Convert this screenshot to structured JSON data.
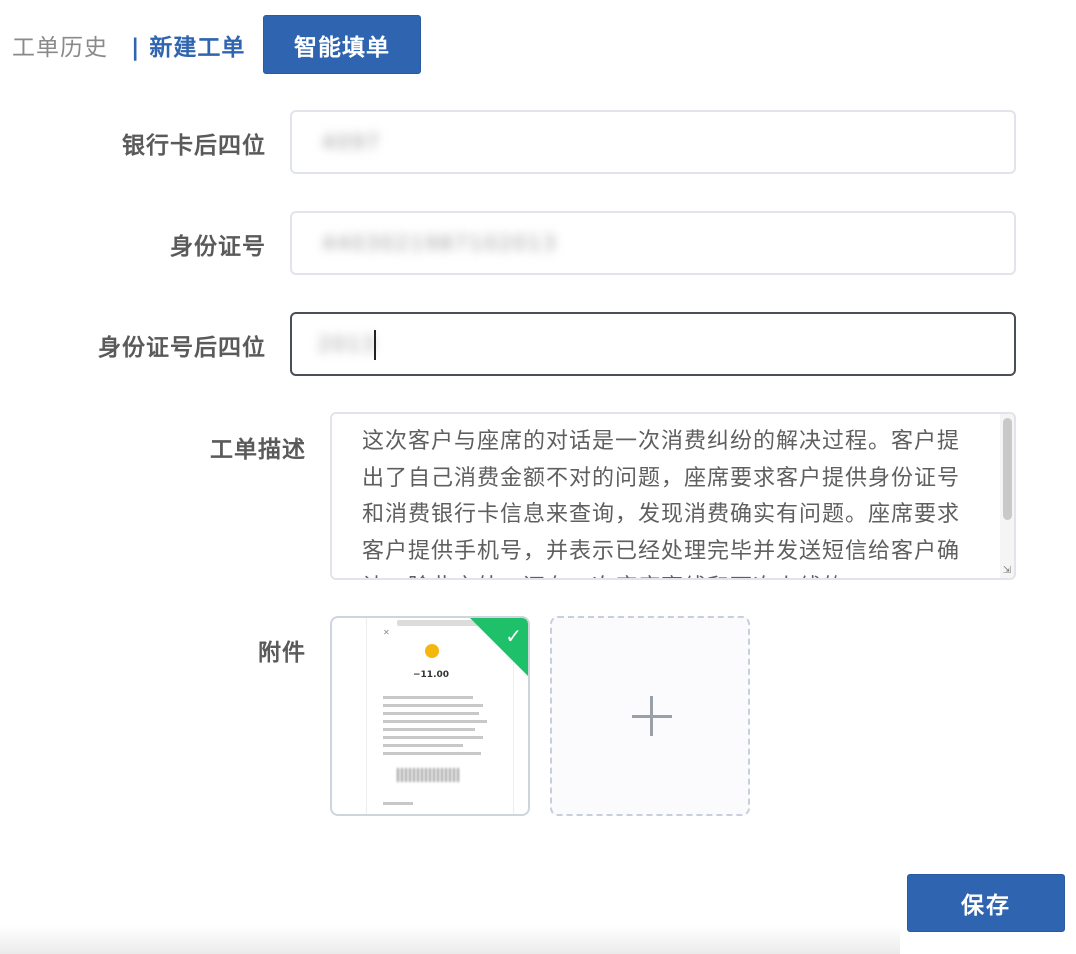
{
  "tabs": {
    "history": "工单历史",
    "new": "| 新建工单",
    "smart": "智能填单"
  },
  "form": {
    "bank_last4": {
      "label": "银行卡后四位",
      "value": "4097"
    },
    "id_number": {
      "label": "身份证号",
      "value": "4403021987102013"
    },
    "id_last4": {
      "label": "身份证号后四位",
      "value": "2013"
    },
    "description": {
      "label": "工单描述",
      "value": "这次客户与座席的对话是一次消费纠纷的解决过程。客户提出了自己消费金额不对的问题，座席要求客户提供身份证号和消费银行卡信息来查询，发现消费确实有问题。座席要求客户提供手机号，并表示已经处理完毕并发送短信给客户确认。除此之外，还有一次座席离线和下次上线的"
    },
    "attachment": {
      "label": "附件",
      "receipt_amount": "−11.00"
    }
  },
  "actions": {
    "save": "保存"
  },
  "colors": {
    "primary": "#2f65b0",
    "success": "#1fc06a"
  },
  "icons": {
    "check": "check-icon",
    "plus": "plus-icon"
  }
}
